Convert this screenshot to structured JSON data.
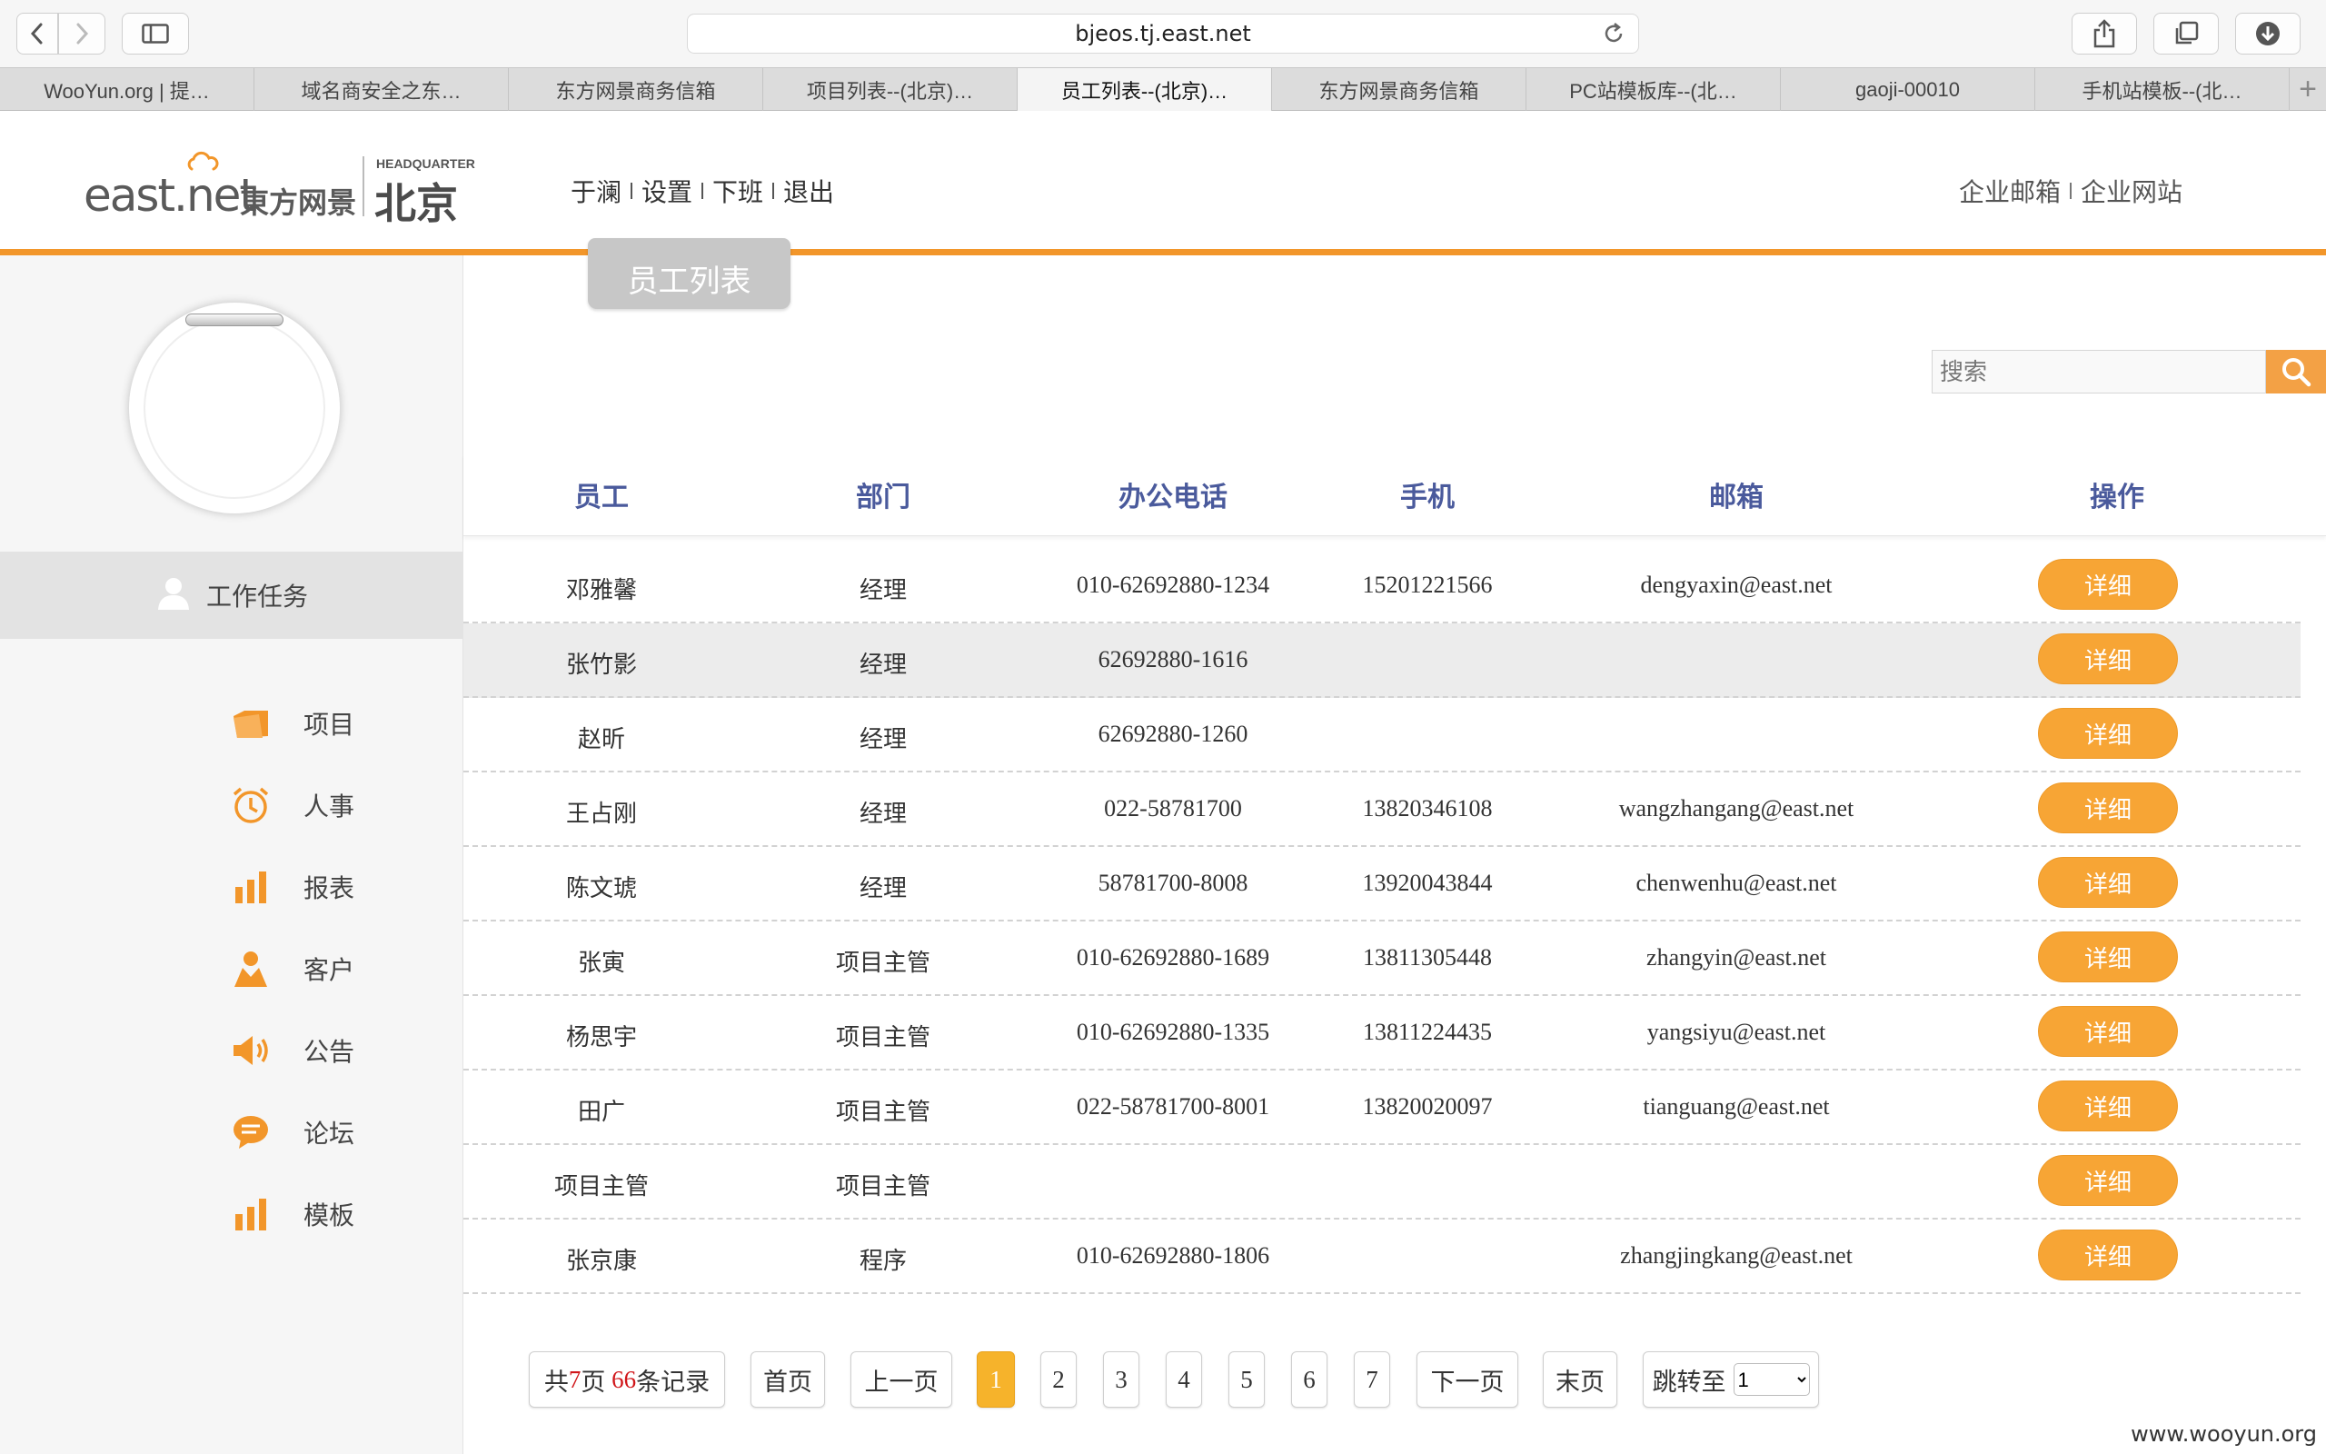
{
  "browser": {
    "url": "bjeos.tj.east.net",
    "tabs": [
      {
        "label": "WooYun.org | 提…"
      },
      {
        "label": "域名商安全之东…"
      },
      {
        "label": "东方网景商务信箱"
      },
      {
        "label": "项目列表--(北京)…"
      },
      {
        "label": "员工列表--(北京)…"
      },
      {
        "label": "东方网景商务信箱"
      },
      {
        "label": "PC站模板库--(北…"
      },
      {
        "label": "gaoji-00010"
      },
      {
        "label": "手机站模板--(北…"
      }
    ],
    "active_tab": 4,
    "add_tab_label": "+"
  },
  "header": {
    "logo": {
      "brand": "east.net",
      "cn": "東方网景",
      "hq": "HEADQUARTER",
      "city": "北京"
    },
    "nav": [
      {
        "label": "于澜"
      },
      {
        "label": "设置"
      },
      {
        "label": "下班"
      },
      {
        "label": "退出"
      }
    ],
    "right_nav": [
      {
        "label": "企业邮箱"
      },
      {
        "label": "企业网站"
      }
    ],
    "page_tab": "员工列表"
  },
  "sidebar": {
    "task_label": "工作任务",
    "menu": [
      {
        "label": "项目",
        "icon": "folder-icon"
      },
      {
        "label": "人事",
        "icon": "alarm-clock-icon"
      },
      {
        "label": "报表",
        "icon": "bar-chart-icon"
      },
      {
        "label": "客户",
        "icon": "person-icon"
      },
      {
        "label": "公告",
        "icon": "megaphone-icon"
      },
      {
        "label": "论坛",
        "icon": "chat-bubble-icon"
      },
      {
        "label": "模板",
        "icon": "bar-chart-icon"
      }
    ],
    "accent_color": "#f2962a"
  },
  "search": {
    "placeholder": "搜索",
    "value": ""
  },
  "table": {
    "columns": [
      "员工",
      "部门",
      "办公电话",
      "手机",
      "邮箱",
      "操作"
    ],
    "action_label": "详细",
    "highlighted_row": 1,
    "rows": [
      {
        "name": "邓雅馨",
        "dept": "经理",
        "office": "010-62692880-1234",
        "mobile": "15201221566",
        "email": "dengyaxin@east.net"
      },
      {
        "name": "张竹影",
        "dept": "经理",
        "office": "62692880-1616",
        "mobile": "",
        "email": ""
      },
      {
        "name": "赵昕",
        "dept": "经理",
        "office": "62692880-1260",
        "mobile": "",
        "email": ""
      },
      {
        "name": "王占刚",
        "dept": "经理",
        "office": "022-58781700",
        "mobile": "13820346108",
        "email": "wangzhangang@east.net"
      },
      {
        "name": "陈文琥",
        "dept": "经理",
        "office": "58781700-8008",
        "mobile": "13920043844",
        "email": "chenwenhu@east.net"
      },
      {
        "name": "张寅",
        "dept": "项目主管",
        "office": "010-62692880-1689",
        "mobile": "13811305448",
        "email": "zhangyin@east.net"
      },
      {
        "name": "杨思宇",
        "dept": "项目主管",
        "office": "010-62692880-1335",
        "mobile": "13811224435",
        "email": "yangsiyu@east.net"
      },
      {
        "name": "田广",
        "dept": "项目主管",
        "office": "022-58781700-8001",
        "mobile": "13820020097",
        "email": "tianguang@east.net"
      },
      {
        "name": "项目主管",
        "dept": "项目主管",
        "office": "",
        "mobile": "",
        "email": ""
      },
      {
        "name": "张京康",
        "dept": "程序",
        "office": "010-62692880-1806",
        "mobile": "",
        "email": "zhangjingkang@east.net"
      }
    ]
  },
  "pagination": {
    "summary_prefix": "共",
    "total_pages": "7",
    "pages_word": "页 ",
    "total_records": "66",
    "records_word": "条记录",
    "first": "首页",
    "prev": "上一页",
    "pages": [
      "1",
      "2",
      "3",
      "4",
      "5",
      "6",
      "7"
    ],
    "current_page": "1",
    "next": "下一页",
    "last": "末页",
    "jump_label": "跳转至",
    "jump_value": "1"
  },
  "watermark": "www.wooyun.org"
}
